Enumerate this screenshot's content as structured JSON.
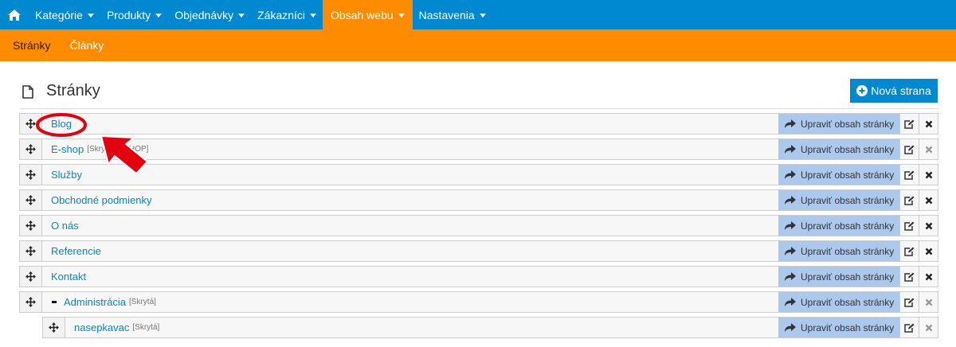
{
  "nav": {
    "items": [
      {
        "label": "Kategórie"
      },
      {
        "label": "Produkty"
      },
      {
        "label": "Objednávky"
      },
      {
        "label": "Zákazníci"
      },
      {
        "label": "Obsah webu"
      },
      {
        "label": "Nastavenia"
      }
    ],
    "active_index": 4
  },
  "subnav": {
    "items": [
      {
        "label": "Stránky"
      },
      {
        "label": "Články"
      }
    ]
  },
  "page": {
    "title": "Stránky",
    "new_button": "Nová strana"
  },
  "rows": [
    {
      "label": "Blog",
      "tag": "",
      "edit": "Upraviť obsah stránky",
      "delete_disabled": false
    },
    {
      "label": "E-shop",
      "tag": "[Skrytá] [ESHOP]",
      "edit": "Upraviť obsah stránky",
      "delete_disabled": true
    },
    {
      "label": "Služby",
      "tag": "",
      "edit": "Upraviť obsah stránky",
      "delete_disabled": false
    },
    {
      "label": "Obchodné podmienky",
      "tag": "",
      "edit": "Upraviť obsah stránky",
      "delete_disabled": false
    },
    {
      "label": "O nás",
      "tag": "",
      "edit": "Upraviť obsah stránky",
      "delete_disabled": false
    },
    {
      "label": "Referencie",
      "tag": "",
      "edit": "Upraviť obsah stránky",
      "delete_disabled": false
    },
    {
      "label": "Kontakt",
      "tag": "",
      "edit": "Upraviť obsah stránky",
      "delete_disabled": false
    },
    {
      "label": "Administrácia",
      "tag": "[Skrytá]",
      "edit": "Upraviť obsah stránky",
      "delete_disabled": true
    },
    {
      "label": "nasepkavac",
      "tag": "[Skrytá]",
      "edit": "Upraviť obsah stránky",
      "delete_disabled": true
    }
  ],
  "icons": {
    "home": "home-icon",
    "doc": "document-icon",
    "plus": "plus-circle-icon",
    "move": "move-icon",
    "share": "share-arrow-icon",
    "edit": "edit-icon",
    "delete": "close-icon"
  },
  "colors": {
    "primary": "#0089d1",
    "accent": "#ff8c00",
    "edit_button": "#aac9ec",
    "annotation": "#e3000f"
  }
}
